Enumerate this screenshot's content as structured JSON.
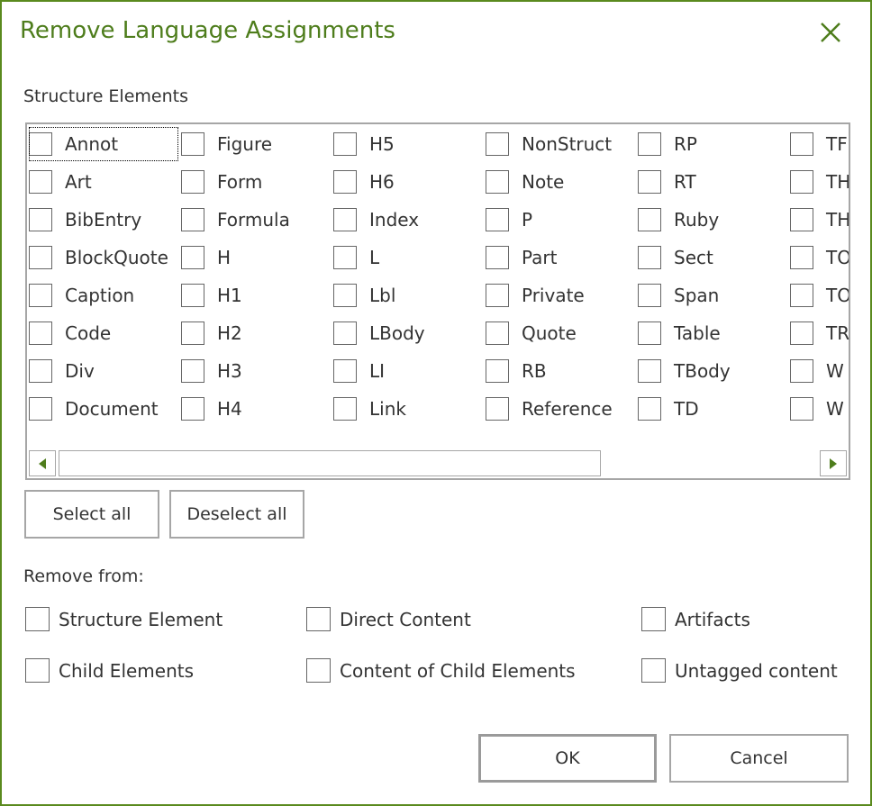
{
  "dialog": {
    "title": "Remove Language Assignments",
    "accent_color": "#5a8a1e",
    "close_icon": "close-icon"
  },
  "structure": {
    "label": "Structure Elements",
    "columns": [
      [
        "Annot",
        "Art",
        "BibEntry",
        "BlockQuote",
        "Caption",
        "Code",
        "Div",
        "Document"
      ],
      [
        "Figure",
        "Form",
        "Formula",
        "H",
        "H1",
        "H2",
        "H3",
        "H4"
      ],
      [
        "H5",
        "H6",
        "Index",
        "L",
        "Lbl",
        "LBody",
        "LI",
        "Link"
      ],
      [
        "NonStruct",
        "Note",
        "P",
        "Part",
        "Private",
        "Quote",
        "RB",
        "Reference"
      ],
      [
        "RP",
        "RT",
        "Ruby",
        "Sect",
        "Span",
        "Table",
        "TBody",
        "TD"
      ],
      [
        "TF",
        "TH",
        "TH",
        "TO",
        "TO",
        "TR",
        "W",
        "W"
      ]
    ],
    "focused_item": "Annot"
  },
  "buttons": {
    "select_all": "Select all",
    "deselect_all": "Deselect all",
    "ok": "OK",
    "cancel": "Cancel"
  },
  "remove_from": {
    "label": "Remove from:",
    "options": [
      {
        "id": "structure-element",
        "label": "Structure Element"
      },
      {
        "id": "direct-content",
        "label": "Direct Content"
      },
      {
        "id": "artifacts",
        "label": "Artifacts"
      },
      {
        "id": "child-elements",
        "label": "Child Elements"
      },
      {
        "id": "content-of-child-elements",
        "label": "Content of Child Elements"
      },
      {
        "id": "untagged-content",
        "label": "Untagged content"
      }
    ]
  }
}
